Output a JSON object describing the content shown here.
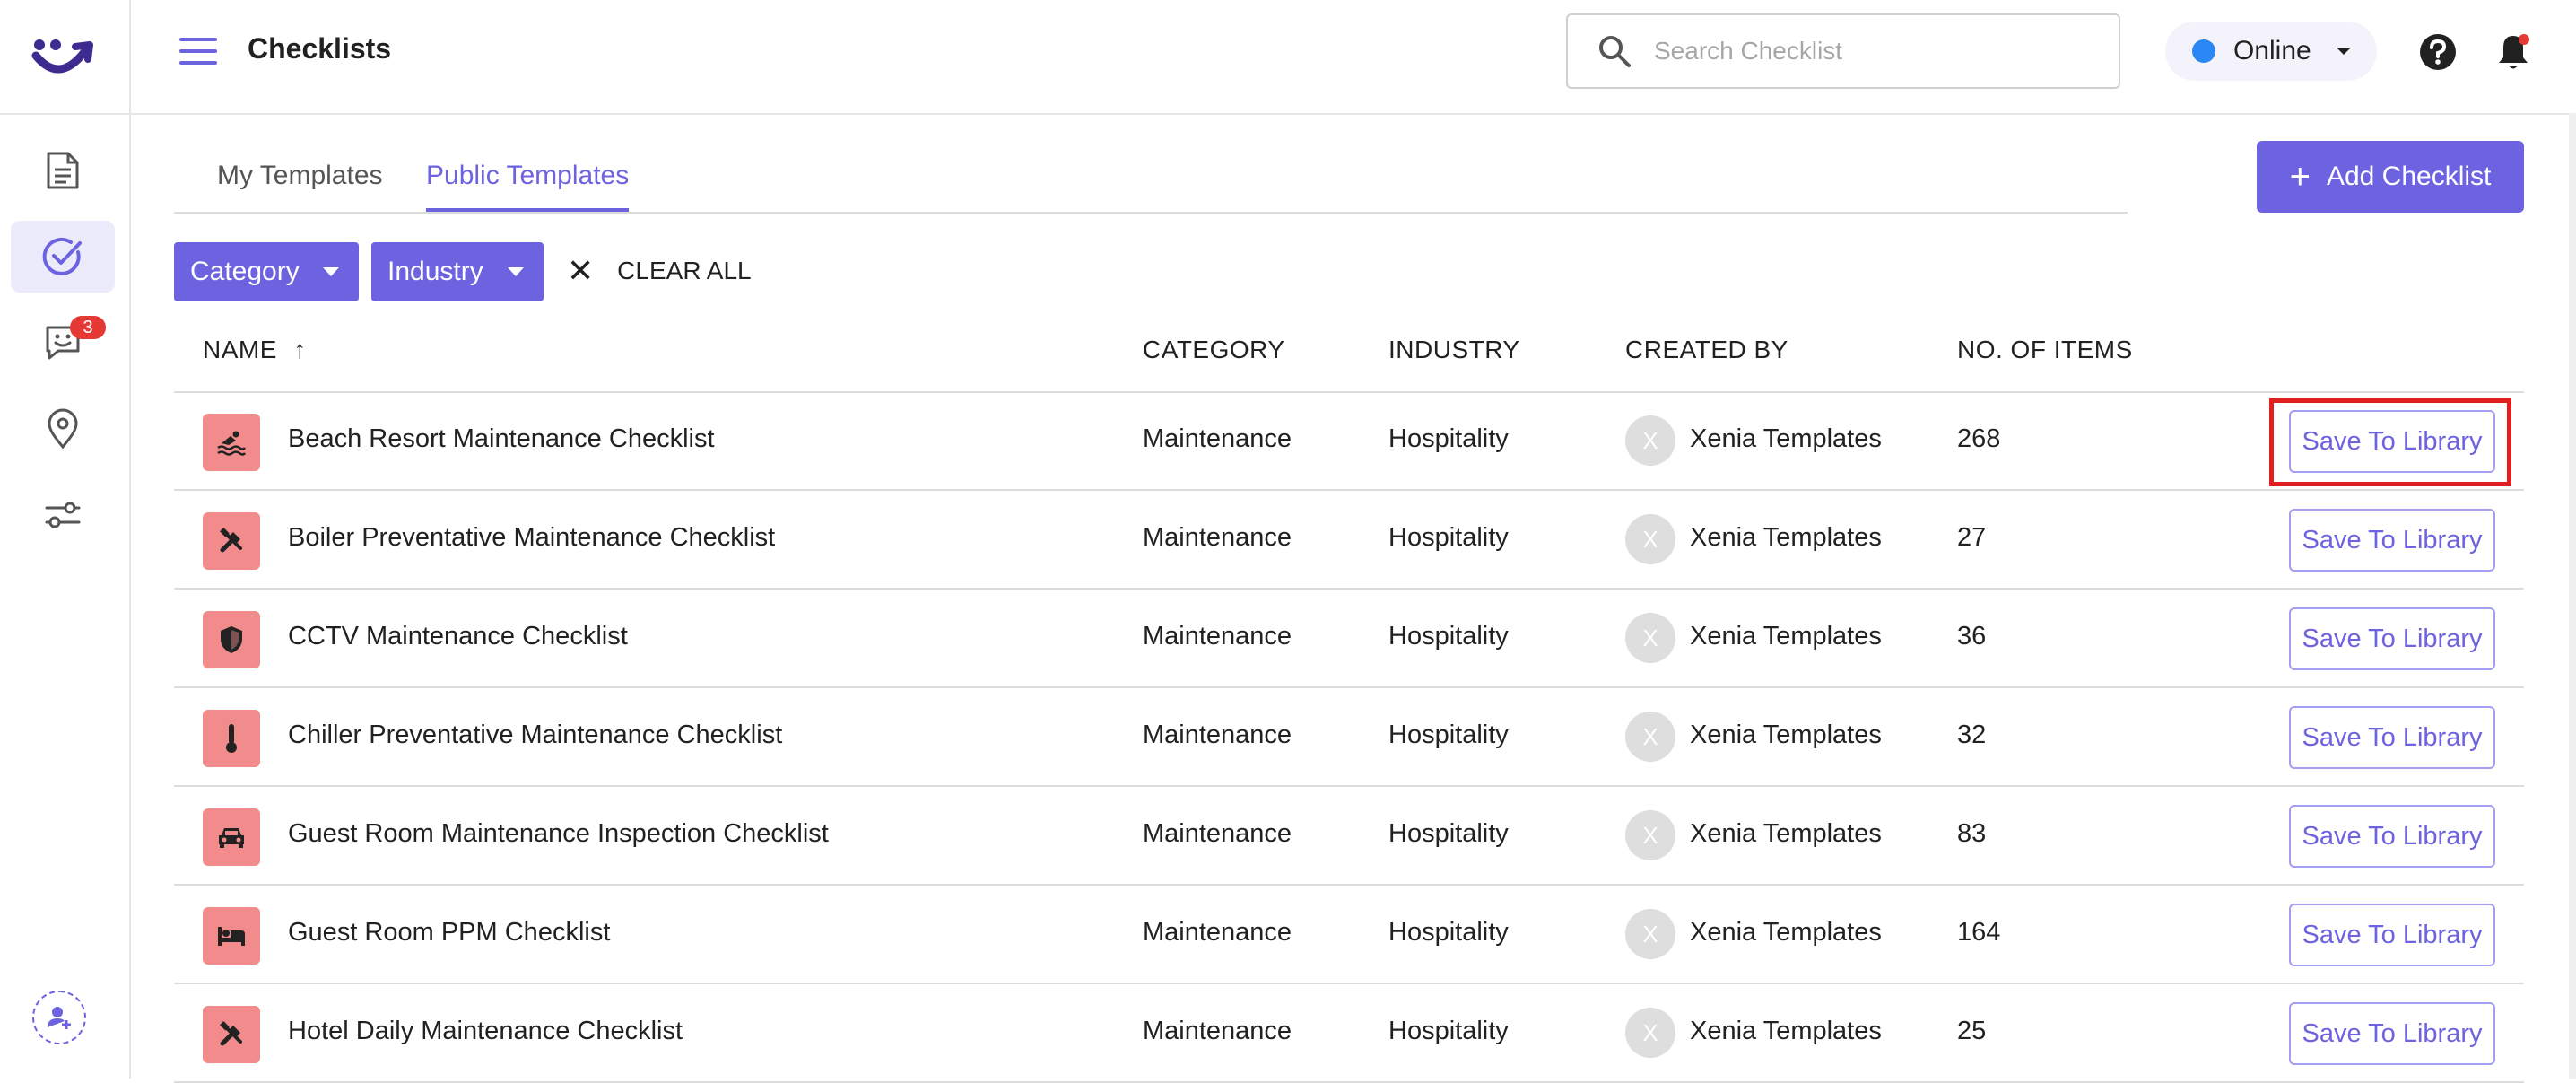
{
  "header": {
    "title": "Checklists",
    "search_placeholder": "Search Checklist",
    "status_label": "Online"
  },
  "sidebar": {
    "chat_badge_count": "3",
    "items": [
      "templates",
      "checklists",
      "messages",
      "locations",
      "settings"
    ]
  },
  "tabs": [
    {
      "label": "My Templates",
      "active": false
    },
    {
      "label": "Public Templates",
      "active": true
    }
  ],
  "toolbar": {
    "add_label": "Add Checklist",
    "category_filter": "Category",
    "industry_filter": "Industry",
    "clear_all": "CLEAR ALL"
  },
  "table": {
    "columns": [
      "NAME",
      "CATEGORY",
      "INDUSTRY",
      "CREATED BY",
      "NO. OF ITEMS"
    ],
    "rows": [
      {
        "name": "Beach Resort Maintenance Checklist",
        "category": "Maintenance",
        "industry": "Hospitality",
        "avatar": "X",
        "created_by": "Xenia Templates",
        "items": "268",
        "icon": "pool-icon"
      },
      {
        "name": "Boiler Preventative Maintenance Checklist",
        "category": "Maintenance",
        "industry": "Hospitality",
        "avatar": "X",
        "created_by": "Xenia Templates",
        "items": "27",
        "icon": "tools-icon"
      },
      {
        "name": "CCTV Maintenance Checklist",
        "category": "Maintenance",
        "industry": "Hospitality",
        "avatar": "X",
        "created_by": "Xenia Templates",
        "items": "36",
        "icon": "shield-icon"
      },
      {
        "name": "Chiller Preventative Maintenance Checklist",
        "category": "Maintenance",
        "industry": "Hospitality",
        "avatar": "X",
        "created_by": "Xenia Templates",
        "items": "32",
        "icon": "thermometer-icon"
      },
      {
        "name": "Guest Room Maintenance Inspection Checklist",
        "category": "Maintenance",
        "industry": "Hospitality",
        "avatar": "X",
        "created_by": "Xenia Templates",
        "items": "83",
        "icon": "car-icon"
      },
      {
        "name": "Guest Room PPM Checklist",
        "category": "Maintenance",
        "industry": "Hospitality",
        "avatar": "X",
        "created_by": "Xenia Templates",
        "items": "164",
        "icon": "bed-icon"
      },
      {
        "name": "Hotel Daily Maintenance Checklist",
        "category": "Maintenance",
        "industry": "Hospitality",
        "avatar": "X",
        "created_by": "Xenia Templates",
        "items": "25",
        "icon": "tools-icon"
      }
    ],
    "save_label": "Save To Library"
  },
  "colors": {
    "accent": "#6d63e0",
    "row_icon_bg": "#f28c8c",
    "status_online": "#2b87f3",
    "highlight": "#e0201f"
  }
}
